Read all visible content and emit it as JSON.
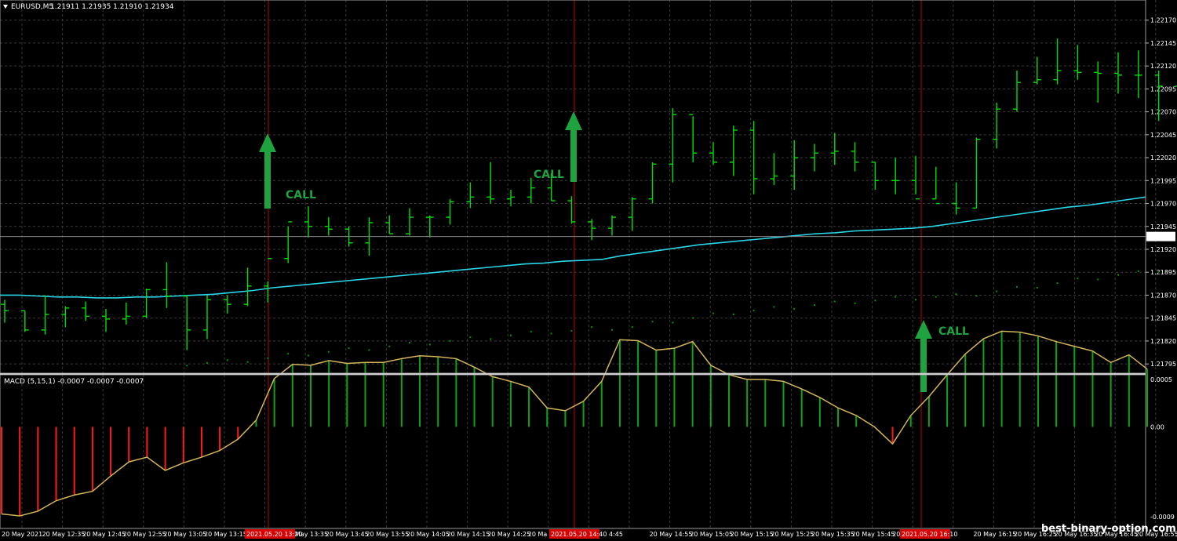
{
  "header": {
    "symbol": "EURUSD,M5",
    "ohlc": "1.21911 1.21935 1.21910 1.21934",
    "macd_label": "MACD (5,15,1) -0.0007 -0.0007 -0.0007"
  },
  "watermark": "best-binary-option.com",
  "colors": {
    "background": "#000000",
    "grid": "#3a3a3a",
    "bar": "#00e000",
    "ma": "#29d6e8",
    "signal": "#d2b45a",
    "hist_pos": "#0fa30f",
    "hist_neg": "#ff1a1a",
    "vline": "#c00000",
    "arrow": "#1fa33f",
    "price_line": "#8c8c8c"
  },
  "chart_data": {
    "type": "bar",
    "price_axis": {
      "range": [
        1.2179,
        1.2218
      ],
      "ticks": [
        "1.22170",
        "1.22145",
        "1.22120",
        "1.22095",
        "1.22070",
        "1.22045",
        "1.22020",
        "1.21995",
        "1.21970",
        "1.21945",
        "1.21920",
        "1.21895",
        "1.21870",
        "1.21845",
        "1.21820",
        "1.21795"
      ],
      "current_price": "1.21934"
    },
    "time_labels": [
      "20 May 2021",
      "20 May 12:35",
      "20 May 12:45",
      "20 May 12:55",
      "20 May 13:05",
      "20 May 13:15",
      "",
      "20 May 13:35",
      "20 May 13:45",
      "20 May 13:55",
      "20 May 14:05",
      "20 May 14:15",
      "20 May 14:25",
      "20 Ma",
      "",
      "4:45",
      "20 May 14:55",
      "20 May 15:05",
      "20 May 15:15",
      "20 May 15:25",
      "20 May 15:35",
      "20 May 15:45",
      "20 May 15:55",
      "",
      "20 May 16:15",
      "20 May 16:25",
      "20 May 16:35",
      "20 May 16:45",
      "20 May 16:55",
      "20 May 17:"
    ],
    "highlighted_time_labels": [
      "2021.05.20 13:20",
      "2021.05.20 14:40",
      "2021.05.20 16:10"
    ],
    "ohlc": [
      [
        1.2186,
        1.21865,
        1.2184,
        1.21853
      ],
      [
        1.21853,
        1.21853,
        1.2183,
        1.21832
      ],
      [
        1.21832,
        1.2187,
        1.21827,
        1.21849
      ],
      [
        1.21849,
        1.21858,
        1.21835,
        1.21856
      ],
      [
        1.21856,
        1.21863,
        1.21842,
        1.21847
      ],
      [
        1.21847,
        1.21855,
        1.2183,
        1.21844
      ],
      [
        1.21844,
        1.21862,
        1.21838,
        1.21847
      ],
      [
        1.21847,
        1.21877,
        1.21845,
        1.21876
      ],
      [
        1.21876,
        1.21906,
        1.21856,
        1.21869
      ],
      [
        1.21869,
        1.2187,
        1.2181,
        1.21832
      ],
      [
        1.21832,
        1.2187,
        1.21822,
        1.21865
      ],
      [
        1.21865,
        1.2187,
        1.2185,
        1.2186
      ],
      [
        1.2186,
        1.219,
        1.21858,
        1.2188
      ],
      [
        1.2188,
        1.21885,
        1.21862,
        1.2191
      ],
      [
        1.2191,
        1.21945,
        1.21905,
        1.2195
      ],
      [
        1.2195,
        1.21967,
        1.21933,
        1.21945
      ],
      [
        1.21945,
        1.21955,
        1.21935,
        1.21942
      ],
      [
        1.21942,
        1.21945,
        1.21923,
        1.21927
      ],
      [
        1.21927,
        1.21955,
        1.21913,
        1.21949
      ],
      [
        1.21949,
        1.21957,
        1.21937,
        1.21937
      ],
      [
        1.21937,
        1.21965,
        1.21935,
        1.21955
      ],
      [
        1.21955,
        1.21957,
        1.21933,
        1.21955
      ],
      [
        1.21955,
        1.21975,
        1.21947,
        1.21972
      ],
      [
        1.21972,
        1.21993,
        1.21965,
        1.21977
      ],
      [
        1.21977,
        1.22015,
        1.2197,
        1.21975
      ],
      [
        1.21975,
        1.21985,
        1.21967,
        1.21977
      ],
      [
        1.21977,
        1.21998,
        1.2197,
        1.21987
      ],
      [
        1.21987,
        1.22003,
        1.21973,
        1.21973
      ],
      [
        1.21973,
        1.21978,
        1.21948,
        1.2195
      ],
      [
        1.2195,
        1.21953,
        1.2193,
        1.21943
      ],
      [
        1.21943,
        1.21957,
        1.21935,
        1.21955
      ],
      [
        1.21955,
        1.21977,
        1.2194,
        1.21975
      ],
      [
        1.21975,
        1.22015,
        1.2197,
        1.22013
      ],
      [
        1.22013,
        1.22074,
        1.21993,
        1.22067
      ],
      [
        1.22067,
        1.22065,
        1.22015,
        1.22025
      ],
      [
        1.22025,
        1.22037,
        1.22012,
        1.22015
      ],
      [
        1.22015,
        1.22055,
        1.22,
        1.2205
      ],
      [
        1.2205,
        1.2206,
        1.2198,
        1.21997
      ],
      [
        1.21997,
        1.22025,
        1.2199,
        1.22
      ],
      [
        1.22,
        1.22039,
        1.21985,
        1.2202
      ],
      [
        1.2202,
        1.22035,
        1.22005,
        1.22025
      ],
      [
        1.22025,
        1.22047,
        1.22012,
        1.22027
      ],
      [
        1.22027,
        1.22037,
        1.22005,
        1.22015
      ],
      [
        1.22015,
        1.22015,
        1.21985,
        1.21995
      ],
      [
        1.21995,
        1.2202,
        1.2198,
        1.21995
      ],
      [
        1.21995,
        1.22022,
        1.2198,
        1.21975
      ],
      [
        1.21975,
        1.2201,
        1.21975,
        1.2197
      ],
      [
        1.2197,
        1.21993,
        1.21958,
        1.21965
      ],
      [
        1.21965,
        1.22042,
        1.21965,
        1.2204
      ],
      [
        1.2204,
        1.2208,
        1.2203,
        1.22073
      ],
      [
        1.22073,
        1.22115,
        1.2207,
        1.22102
      ],
      [
        1.22102,
        1.2213,
        1.221,
        1.22105
      ],
      [
        1.22105,
        1.2215,
        1.221,
        1.22115
      ],
      [
        1.22115,
        1.22143,
        1.22105,
        1.22113
      ],
      [
        1.22113,
        1.22125,
        1.2208,
        1.22112
      ],
      [
        1.22112,
        1.22135,
        1.2209,
        1.2211
      ],
      [
        1.2211,
        1.22137,
        1.22085,
        1.2211
      ],
      [
        1.2211,
        1.22115,
        1.2206,
        1.22098
      ],
      [
        1.22098,
        1.22172,
        1.22095,
        1.22145
      ],
      [
        1.22145,
        1.2215,
        1.2192,
        1.21934
      ]
    ],
    "moving_average": [
      1.2187,
      1.2187,
      1.21869,
      1.21868,
      1.21868,
      1.21867,
      1.21867,
      1.21868,
      1.21868,
      1.21869,
      1.2187,
      1.21871,
      1.21873,
      1.21875,
      1.21878,
      1.2188,
      1.21882,
      1.21884,
      1.21886,
      1.21888,
      1.2189,
      1.21892,
      1.21894,
      1.21896,
      1.21898,
      1.219,
      1.21902,
      1.21904,
      1.21905,
      1.21907,
      1.21908,
      1.21909,
      1.21913,
      1.21916,
      1.21919,
      1.21922,
      1.21925,
      1.21927,
      1.21929,
      1.21931,
      1.21933,
      1.21935,
      1.21937,
      1.21938,
      1.2194,
      1.21941,
      1.21942,
      1.21943,
      1.21945,
      1.21948,
      1.21951,
      1.21954,
      1.21957,
      1.2196,
      1.21963,
      1.21966,
      1.21968,
      1.21971,
      1.21974,
      1.21977
    ],
    "macd": {
      "range": [
        -0.00099,
        0.0005
      ],
      "ticks": [
        "0.0005",
        "0.00",
        "-0.0009"
      ],
      "values": [
        -0.00092,
        -0.00094,
        -0.00089,
        -0.00078,
        -0.00072,
        -0.00068,
        -0.00052,
        -0.00037,
        -0.00032,
        -0.00046,
        -0.00038,
        -0.00032,
        -0.00025,
        -0.00013,
        7e-05,
        0.00051,
        0.00066,
        0.00065,
        0.0007,
        0.00067,
        0.00068,
        0.00068,
        0.00072,
        0.00075,
        0.00074,
        0.00072,
        0.00063,
        0.00053,
        0.00048,
        0.00042,
        0.0002,
        0.00017,
        0.00027,
        0.00048,
        0.00092,
        0.00091,
        0.00081,
        0.00083,
        0.0009,
        0.00065,
        0.00055,
        0.0005,
        0.0005,
        0.00048,
        0.0004,
        0.00031,
        0.0002,
        0.00012,
        0.0,
        -0.00018,
        0.00012,
        0.00032,
        0.00055,
        0.00077,
        0.00093,
        0.00101,
        0.001,
        0.00096,
        0.0009,
        0.00085,
        0.0008,
        0.00068,
        0.00076,
        0.00061
      ]
    }
  },
  "signals": [
    {
      "label": "CALL"
    },
    {
      "label": "CALL"
    },
    {
      "label": "CALL"
    }
  ]
}
